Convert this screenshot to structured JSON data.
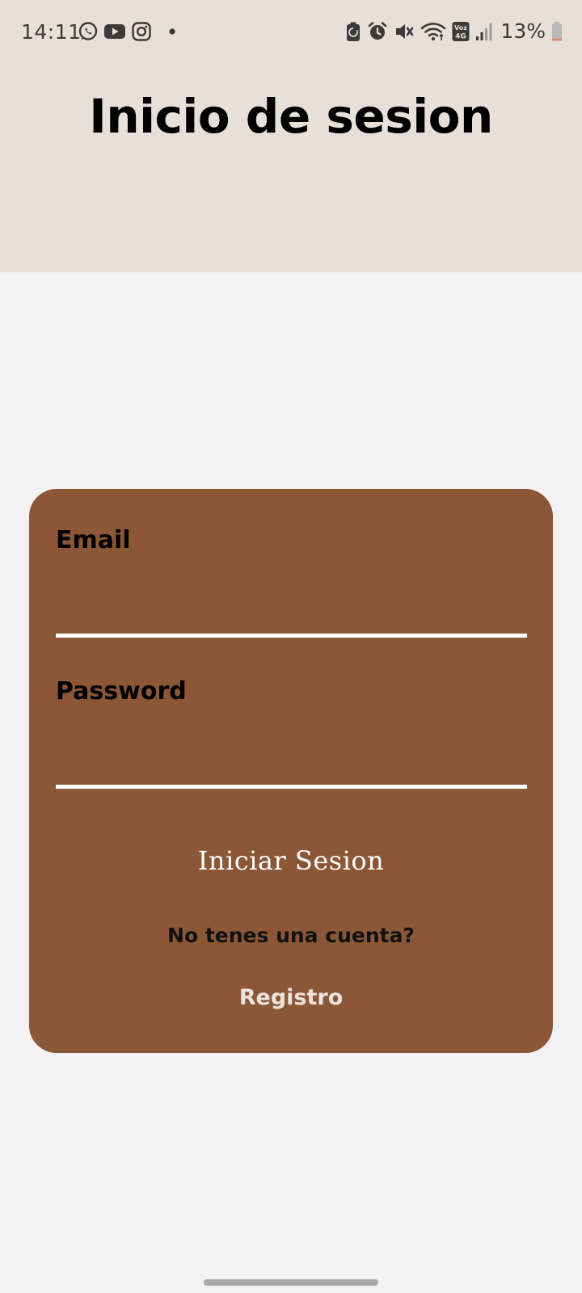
{
  "status_bar": {
    "time": "14:11",
    "left_icons": [
      "whatsapp-icon",
      "youtube-icon",
      "instagram-icon",
      "notification-dot-icon"
    ],
    "right_icons": [
      "data-saver-icon",
      "alarm-icon",
      "mute-icon",
      "wifi-icon",
      "volte-4g-icon",
      "signal-icon",
      "battery-icon"
    ],
    "volte_label_top": "Voz",
    "volte_label_bottom": "4G",
    "battery_percent": "13%",
    "battery_level": 0.13
  },
  "header": {
    "title": "Inicio de sesion",
    "background": "#e6e0d8"
  },
  "login_form": {
    "background": "#8b5736",
    "email_label": "Email",
    "email_value": "",
    "password_label": "Password",
    "password_value": "",
    "submit_label": "Iniciar Sesion",
    "no_account_text": "No tenes una cuenta?",
    "register_label": "Registro"
  },
  "colors": {
    "page_background": "#f2f2f2",
    "input_underline": "#ffffff",
    "register_text": "#ece4dc"
  }
}
